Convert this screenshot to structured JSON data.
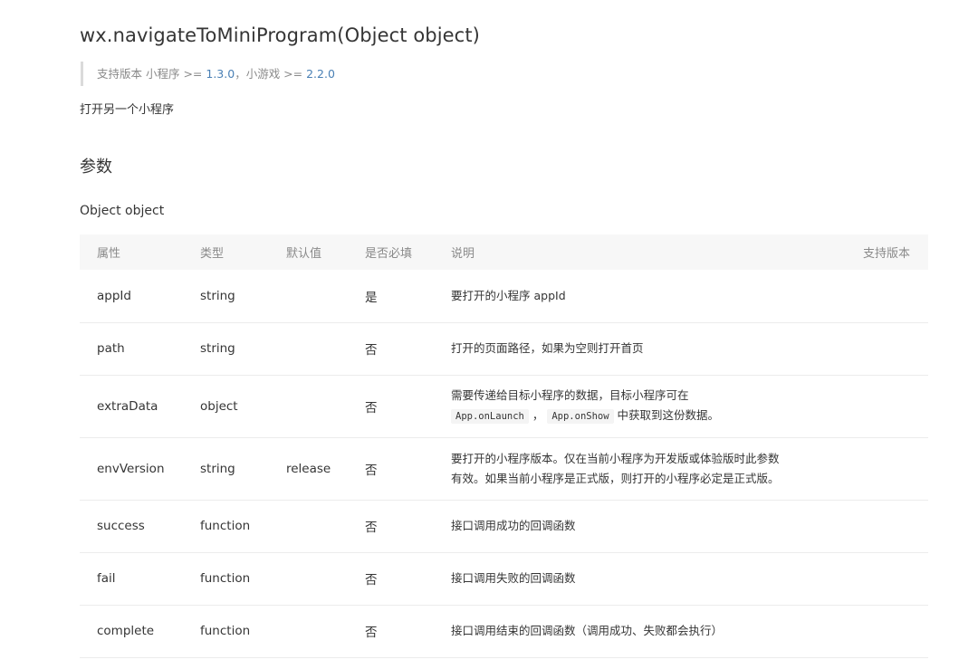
{
  "header": {
    "title": "wx.navigateToMiniProgram(Object object)",
    "support_prefix": "支持版本 小程序 >= ",
    "support_mp_version": "1.3.0",
    "support_mid": "，小游戏 >= ",
    "support_game_version": "2.2.0",
    "description": "打开另一个小程序"
  },
  "params": {
    "section_title": "参数",
    "object_label": "Object object",
    "columns": {
      "attr": "属性",
      "type": "类型",
      "default": "默认值",
      "required": "是否必填",
      "desc": "说明",
      "version": "支持版本"
    },
    "rows": [
      {
        "attr": "appId",
        "type": "string",
        "default": "",
        "required": "是",
        "desc": "要打开的小程序 appId"
      },
      {
        "attr": "path",
        "type": "string",
        "default": "",
        "required": "否",
        "desc": "打开的页面路径，如果为空则打开首页"
      },
      {
        "attr": "extraData",
        "type": "object",
        "default": "",
        "required": "否",
        "desc_line1": "需要传递给目标小程序的数据，目标小程序可在",
        "code1": "App.onLaunch",
        "sep": "，",
        "code2": "App.onShow",
        "desc_suffix": "中获取到这份数据。"
      },
      {
        "attr": "envVersion",
        "type": "string",
        "default": "release",
        "required": "否",
        "desc_line1": "要打开的小程序版本。仅在当前小程序为开发版或体验版时此参数",
        "desc_line2": "有效。如果当前小程序是正式版，则打开的小程序必定是正式版。"
      },
      {
        "attr": "success",
        "type": "function",
        "default": "",
        "required": "否",
        "desc": "接口调用成功的回调函数"
      },
      {
        "attr": "fail",
        "type": "function",
        "default": "",
        "required": "否",
        "desc": "接口调用失败的回调函数"
      },
      {
        "attr": "complete",
        "type": "function",
        "default": "",
        "required": "否",
        "desc": "接口调用结束的回调函数（调用成功、失败都会执行）"
      }
    ]
  }
}
